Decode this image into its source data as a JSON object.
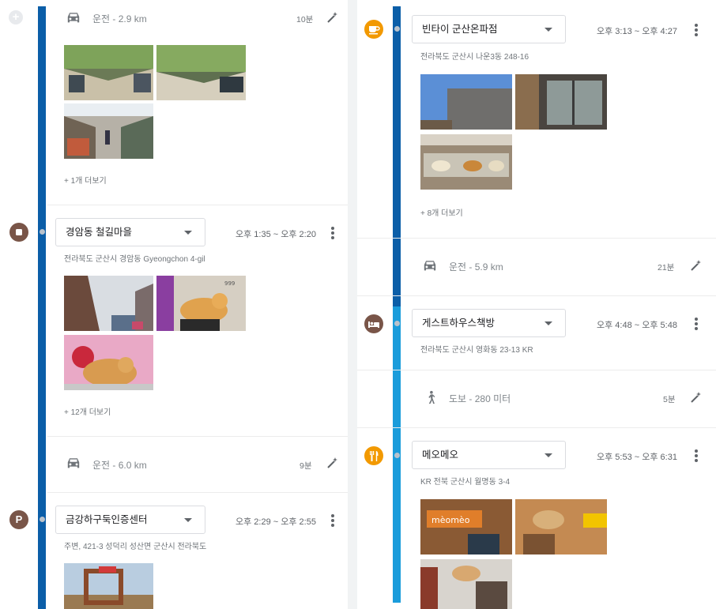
{
  "left": {
    "segment_top": {
      "mode_icon": "car-icon",
      "label": "운전 - 2.9 km",
      "duration": "10분",
      "more": "+ 1개 더보기"
    },
    "place1": {
      "category_icon": "stop-icon",
      "name": "경암동 철길마을",
      "time": "오후 1:35 ~ 오후 2:20",
      "address": "전라북도 군산시 경암동 Gyeongchon 4-gil",
      "more": "+ 12개 더보기"
    },
    "segment_mid": {
      "mode_icon": "car-icon",
      "label": "운전 - 6.0 km",
      "duration": "9분"
    },
    "place2": {
      "category_icon": "parking-icon",
      "category_glyph": "P",
      "name": "금강하구둑인증센터",
      "time": "오후 2:29 ~ 오후 2:55",
      "address": "주변, 421-3 성덕리 성산면 군산시 전라북도"
    }
  },
  "right": {
    "place1": {
      "category_icon": "cafe-icon",
      "name": "빈타이 군산온파점",
      "time": "오후 3:13 ~ 오후 4:27",
      "address": "전라북도 군산시 나운3동 248-16",
      "more": "+ 8개 더보기"
    },
    "segment1": {
      "mode_icon": "car-icon",
      "label": "운전 - 5.9 km",
      "duration": "21분"
    },
    "place2": {
      "category_icon": "bed-icon",
      "name": "게스트하우스책방",
      "time": "오후 4:48 ~ 오후 5:48",
      "address": "전라북도 군산시 영화동 23-13 KR"
    },
    "segment2": {
      "mode_icon": "walk-icon",
      "label": "도보 - 280 미터",
      "duration": "5분"
    },
    "place3": {
      "category_icon": "restaurant-icon",
      "name": "메오메오",
      "time": "오후 5:53 ~ 오후 6:31",
      "address": "KR 전북 군산시 월명동 3-4",
      "sign_text": "mèomèo"
    }
  },
  "colors": {
    "timeline_dark": "#0b5ea8",
    "timeline_light": "#1a9cdb",
    "cafe": "#f29900",
    "restaurant": "#f29900",
    "place": "#795548"
  }
}
